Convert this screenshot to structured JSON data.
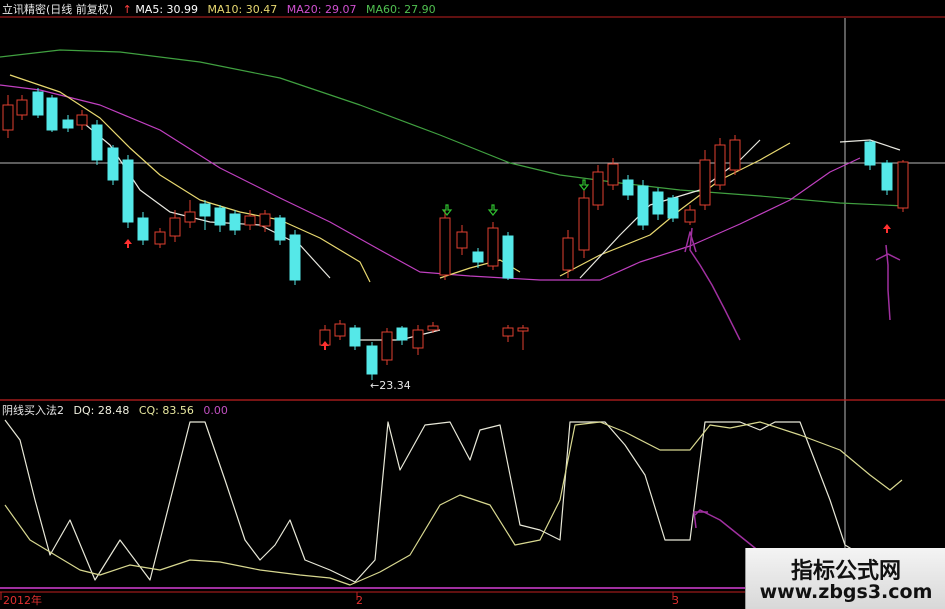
{
  "main_header": {
    "title": "立讯精密(日线 前复权)",
    "ma5": "MA5: 30.99",
    "ma10": "MA10: 30.47",
    "ma20": "MA20: 29.07",
    "ma60": "MA60: 27.90"
  },
  "indicator_header": {
    "name": "阴线买入法2",
    "dq": "DQ: 28.48",
    "cq": "CQ: 83.56",
    "extra": "0.00"
  },
  "low_price_label": "←23.34",
  "x_axis_labels": [
    "2012年",
    "2",
    "3"
  ],
  "watermark": {
    "line1": "指标公式网",
    "line2": "www.zbgs3.com"
  },
  "colors": {
    "background": "#000000",
    "up_candle": "#e04030",
    "down_candle": "#55e8e8",
    "ma5": "#ffffff",
    "ma10": "#e8d870",
    "ma20": "#c040c0",
    "ma60": "#40a040",
    "separator": "#c02020",
    "ind_white": "#e8e8d8",
    "ind_yellow": "#d8d890",
    "annotation": "#a030a0"
  },
  "icons": [
    "buy-arrow-up-icon",
    "sell-arrow-down-icon",
    "red-dot-marker-icon"
  ]
}
